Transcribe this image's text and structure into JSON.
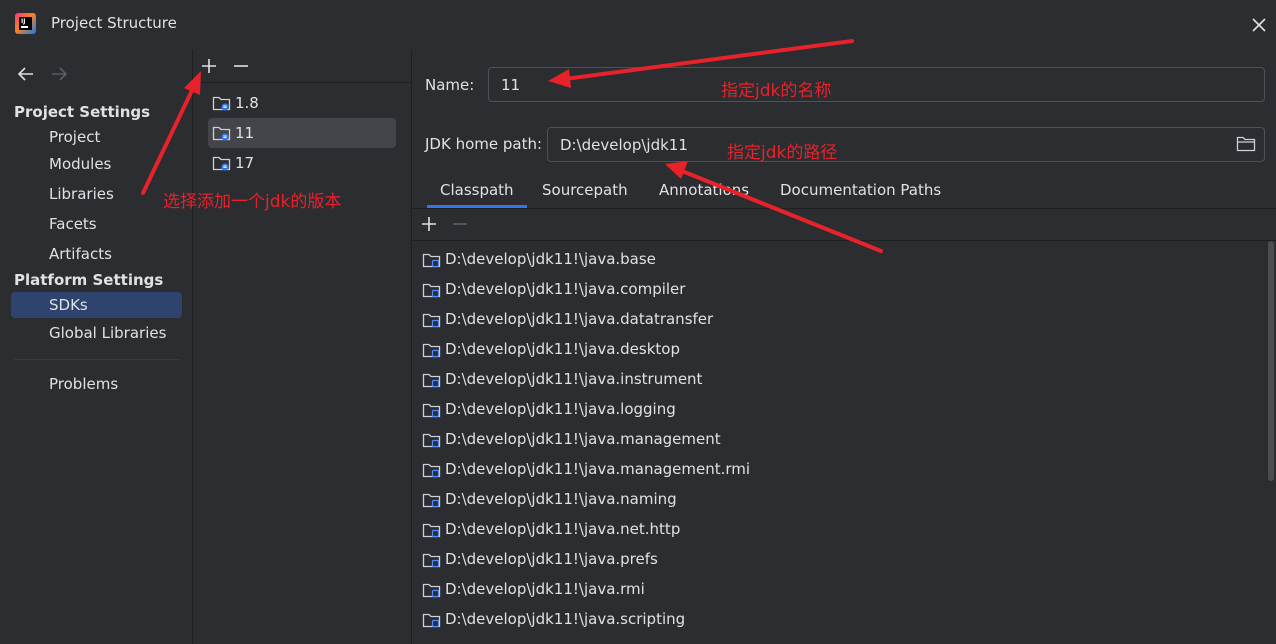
{
  "window": {
    "title": "Project Structure"
  },
  "nav": {
    "project_settings_title": "Project Settings",
    "project_items": [
      "Project",
      "Modules",
      "Libraries",
      "Facets",
      "Artifacts"
    ],
    "platform_settings_title": "Platform Settings",
    "platform_items": [
      "SDKs",
      "Global Libraries"
    ],
    "selected": "SDKs",
    "problems": "Problems"
  },
  "sdks": {
    "items": [
      "1.8",
      "11",
      "17"
    ],
    "selected": "11"
  },
  "detail": {
    "name_label": "Name:",
    "name_value": "11",
    "home_label": "JDK home path:",
    "home_value": "D:\\develop\\jdk11",
    "tabs": [
      "Classpath",
      "Sourcepath",
      "Annotations",
      "Documentation Paths"
    ],
    "active_tab": "Classpath",
    "classpath": [
      "D:\\develop\\jdk11!\\java.base",
      "D:\\develop\\jdk11!\\java.compiler",
      "D:\\develop\\jdk11!\\java.datatransfer",
      "D:\\develop\\jdk11!\\java.desktop",
      "D:\\develop\\jdk11!\\java.instrument",
      "D:\\develop\\jdk11!\\java.logging",
      "D:\\develop\\jdk11!\\java.management",
      "D:\\develop\\jdk11!\\java.management.rmi",
      "D:\\develop\\jdk11!\\java.naming",
      "D:\\develop\\jdk11!\\java.net.http",
      "D:\\develop\\jdk11!\\java.prefs",
      "D:\\develop\\jdk11!\\java.rmi",
      "D:\\develop\\jdk11!\\java.scripting"
    ]
  },
  "annotations": {
    "add_version": "选择添加一个jdk的版本",
    "specify_name": "指定jdk的名称",
    "specify_path": "指定jdk的路径"
  },
  "colors": {
    "background": "#2b2d30",
    "selection": "#2e436e",
    "list_selection": "#43454a",
    "accent": "#3574f0",
    "annotation": "#e8222b",
    "text": "#dfe1e5"
  },
  "icons": [
    "app-logo-icon",
    "close-icon",
    "back-arrow-icon",
    "forward-arrow-icon",
    "add-icon",
    "remove-icon",
    "sdk-folder-icon",
    "folder-browse-icon",
    "library-folder-icon"
  ]
}
